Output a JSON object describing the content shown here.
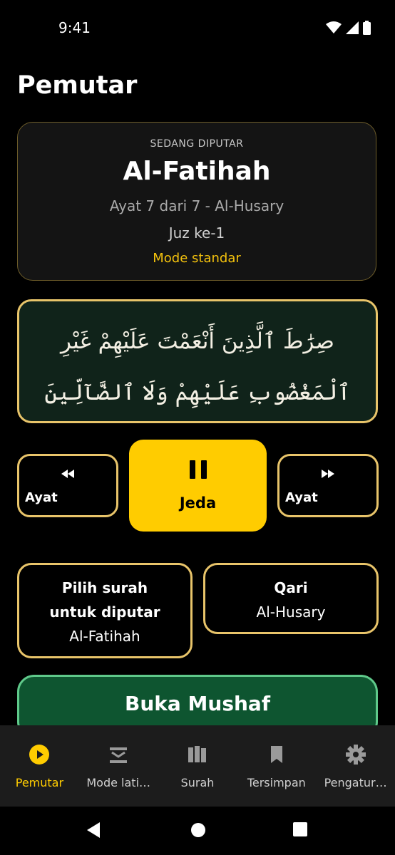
{
  "status_bar": {
    "time": "9:41"
  },
  "page": {
    "title": "Pemutar"
  },
  "now_playing": {
    "eyebrow": "SEDANG DIPUTAR",
    "surah": "Al-Fatihah",
    "meta": "Ayat 7 dari 7 - Al-Husary",
    "juz": "Juz ke-1",
    "mode": "Mode standar"
  },
  "verse": {
    "line1": "صِرَٰطَ ٱلَّذِينَ أَنْعَمْتَ عَلَيْهِمْ غَيْرِ",
    "line2": "ٱلْمَغْضُوبِ عَلَيْهِمْ وَلَا ٱلضَّآلِّينَ"
  },
  "controls": {
    "prev_label": "Ayat",
    "pause_label": "Jeda",
    "next_label": "Ayat"
  },
  "options": {
    "surah_title": "Pilih surah untuk diputar",
    "surah_value": "Al-Fatihah",
    "qari_title": "Qari",
    "qari_value": "Al-Husary"
  },
  "mushaf_button": "Buka Mushaf",
  "bottom_nav": [
    {
      "label": "Pemutar",
      "icon": "play-circle-icon",
      "active": true
    },
    {
      "label": "Mode lati…",
      "icon": "layers-icon",
      "active": false
    },
    {
      "label": "Surah",
      "icon": "library-icon",
      "active": false
    },
    {
      "label": "Tersimpan",
      "icon": "bookmark-icon",
      "active": false
    },
    {
      "label": "Pengatur…",
      "icon": "gear-icon",
      "active": false
    }
  ],
  "colors": {
    "accent": "#ffcc00",
    "card_border": "#e8c46a",
    "verse_bg": "#10231a",
    "mushaf_bg": "#0e5530"
  }
}
